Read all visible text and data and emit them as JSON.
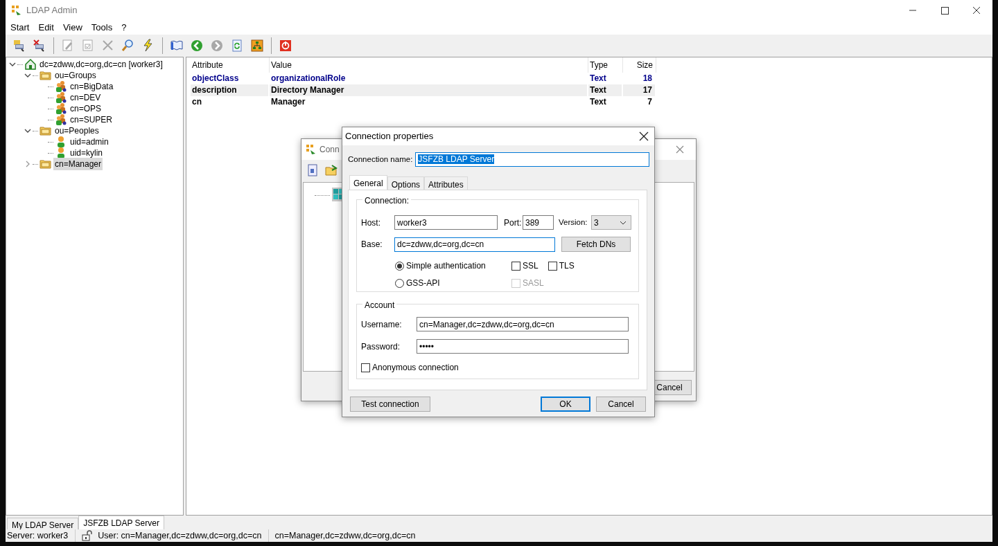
{
  "window": {
    "title": "LDAP Admin"
  },
  "menu": [
    {
      "label": "Start"
    },
    {
      "label": "Edit"
    },
    {
      "label": "View"
    },
    {
      "label": "Tools"
    },
    {
      "label": "?"
    }
  ],
  "toolbar": [
    {
      "kind": "connect",
      "disabled": false
    },
    {
      "kind": "disconnect",
      "disabled": false
    },
    {
      "kind": "separator"
    },
    {
      "kind": "edit",
      "disabled": true
    },
    {
      "kind": "save",
      "disabled": true
    },
    {
      "kind": "delete",
      "disabled": true
    },
    {
      "kind": "search",
      "disabled": false
    },
    {
      "kind": "lightning",
      "disabled": false
    },
    {
      "kind": "separator"
    },
    {
      "kind": "book",
      "disabled": false
    },
    {
      "kind": "back",
      "disabled": false
    },
    {
      "kind": "forward",
      "disabled": true
    },
    {
      "kind": "refresh",
      "disabled": false
    },
    {
      "kind": "tree",
      "disabled": false
    },
    {
      "kind": "separator"
    },
    {
      "kind": "power",
      "disabled": false
    }
  ],
  "tree": [
    {
      "label": "dc=zdww,dc=org,dc=cn [worker3]",
      "kind": "server",
      "expanded": true,
      "selected": false,
      "children": [
        {
          "label": "ou=Groups",
          "kind": "folder",
          "expanded": true,
          "selected": false,
          "children": [
            {
              "label": "cn=BigData",
              "kind": "group",
              "selected": false
            },
            {
              "label": "cn=DEV",
              "kind": "group",
              "selected": false
            },
            {
              "label": "cn=OPS",
              "kind": "group",
              "selected": false
            },
            {
              "label": "cn=SUPER",
              "kind": "group",
              "selected": false
            }
          ]
        },
        {
          "label": "ou=Peoples",
          "kind": "folder",
          "expanded": true,
          "selected": false,
          "children": [
            {
              "label": "uid=admin",
              "kind": "person",
              "selected": false
            },
            {
              "label": "uid=kylin",
              "kind": "person",
              "selected": false
            }
          ]
        },
        {
          "label": "cn=Manager",
          "kind": "folder",
          "expanded": false,
          "selected": true
        }
      ]
    }
  ],
  "table": {
    "columns": [
      "Attribute",
      "Value",
      "Type",
      "Size"
    ],
    "rows": [
      {
        "kind": "objectclass",
        "selected": false,
        "cells": [
          "objectClass",
          "organizationalRole",
          "Text",
          "18"
        ]
      },
      {
        "kind": "plain",
        "selected": true,
        "cells": [
          "description",
          "Directory Manager",
          "Text",
          "17"
        ]
      },
      {
        "kind": "plain",
        "selected": false,
        "cells": [
          "cn",
          "Manager",
          "Text",
          "7"
        ]
      }
    ]
  },
  "server_tabs": [
    {
      "label": "My LDAP Server",
      "selected": false
    },
    {
      "label": "JSFZB LDAP Server",
      "selected": true
    }
  ],
  "status_bar": {
    "server": "Server: worker3",
    "user": "User: cn=Manager,dc=zdww,dc=org,dc=cn",
    "dn": "cn=Manager,dc=zdww,dc=org,dc=cn"
  },
  "back_dialog": {
    "title": "Conn",
    "button": "Cancel"
  },
  "dialog": {
    "title": "Connection properties",
    "connection_name": {
      "label": "Connection name:",
      "value": "JSFZB LDAP Server"
    },
    "tabs": [
      {
        "label": "General",
        "selected": true
      },
      {
        "label": "Options",
        "selected": false
      },
      {
        "label": "Attributes",
        "selected": false
      }
    ],
    "connection": {
      "legend": "Connection:",
      "host_label": "Host:",
      "host": "worker3",
      "port_label": "Port:",
      "port": "389",
      "version_label": "Version:",
      "version": "3",
      "base_label": "Base:",
      "base": "dc=zdww,dc=org,dc=cn",
      "fetch_button": "Fetch DNs",
      "auth": [
        {
          "label": "Simple authentication",
          "selected": true
        },
        {
          "label": "GSS-API",
          "selected": false
        }
      ],
      "options": [
        {
          "label": "SSL",
          "checked": false,
          "disabled": false
        },
        {
          "label": "TLS",
          "checked": false,
          "disabled": false
        },
        {
          "label": "SASL",
          "checked": false,
          "disabled": true
        }
      ]
    },
    "account": {
      "legend": "Account",
      "username_label": "Username:",
      "username": "cn=Manager,dc=zdww,dc=org,dc=cn",
      "password_label": "Password:",
      "password": "•••••",
      "anonymous": {
        "label": "Anonymous connection",
        "checked": false
      }
    },
    "buttons": [
      {
        "label": "Test connection",
        "kind": "secondary"
      },
      {
        "label": "OK",
        "kind": "default"
      },
      {
        "label": "Cancel",
        "kind": "plain"
      }
    ]
  }
}
